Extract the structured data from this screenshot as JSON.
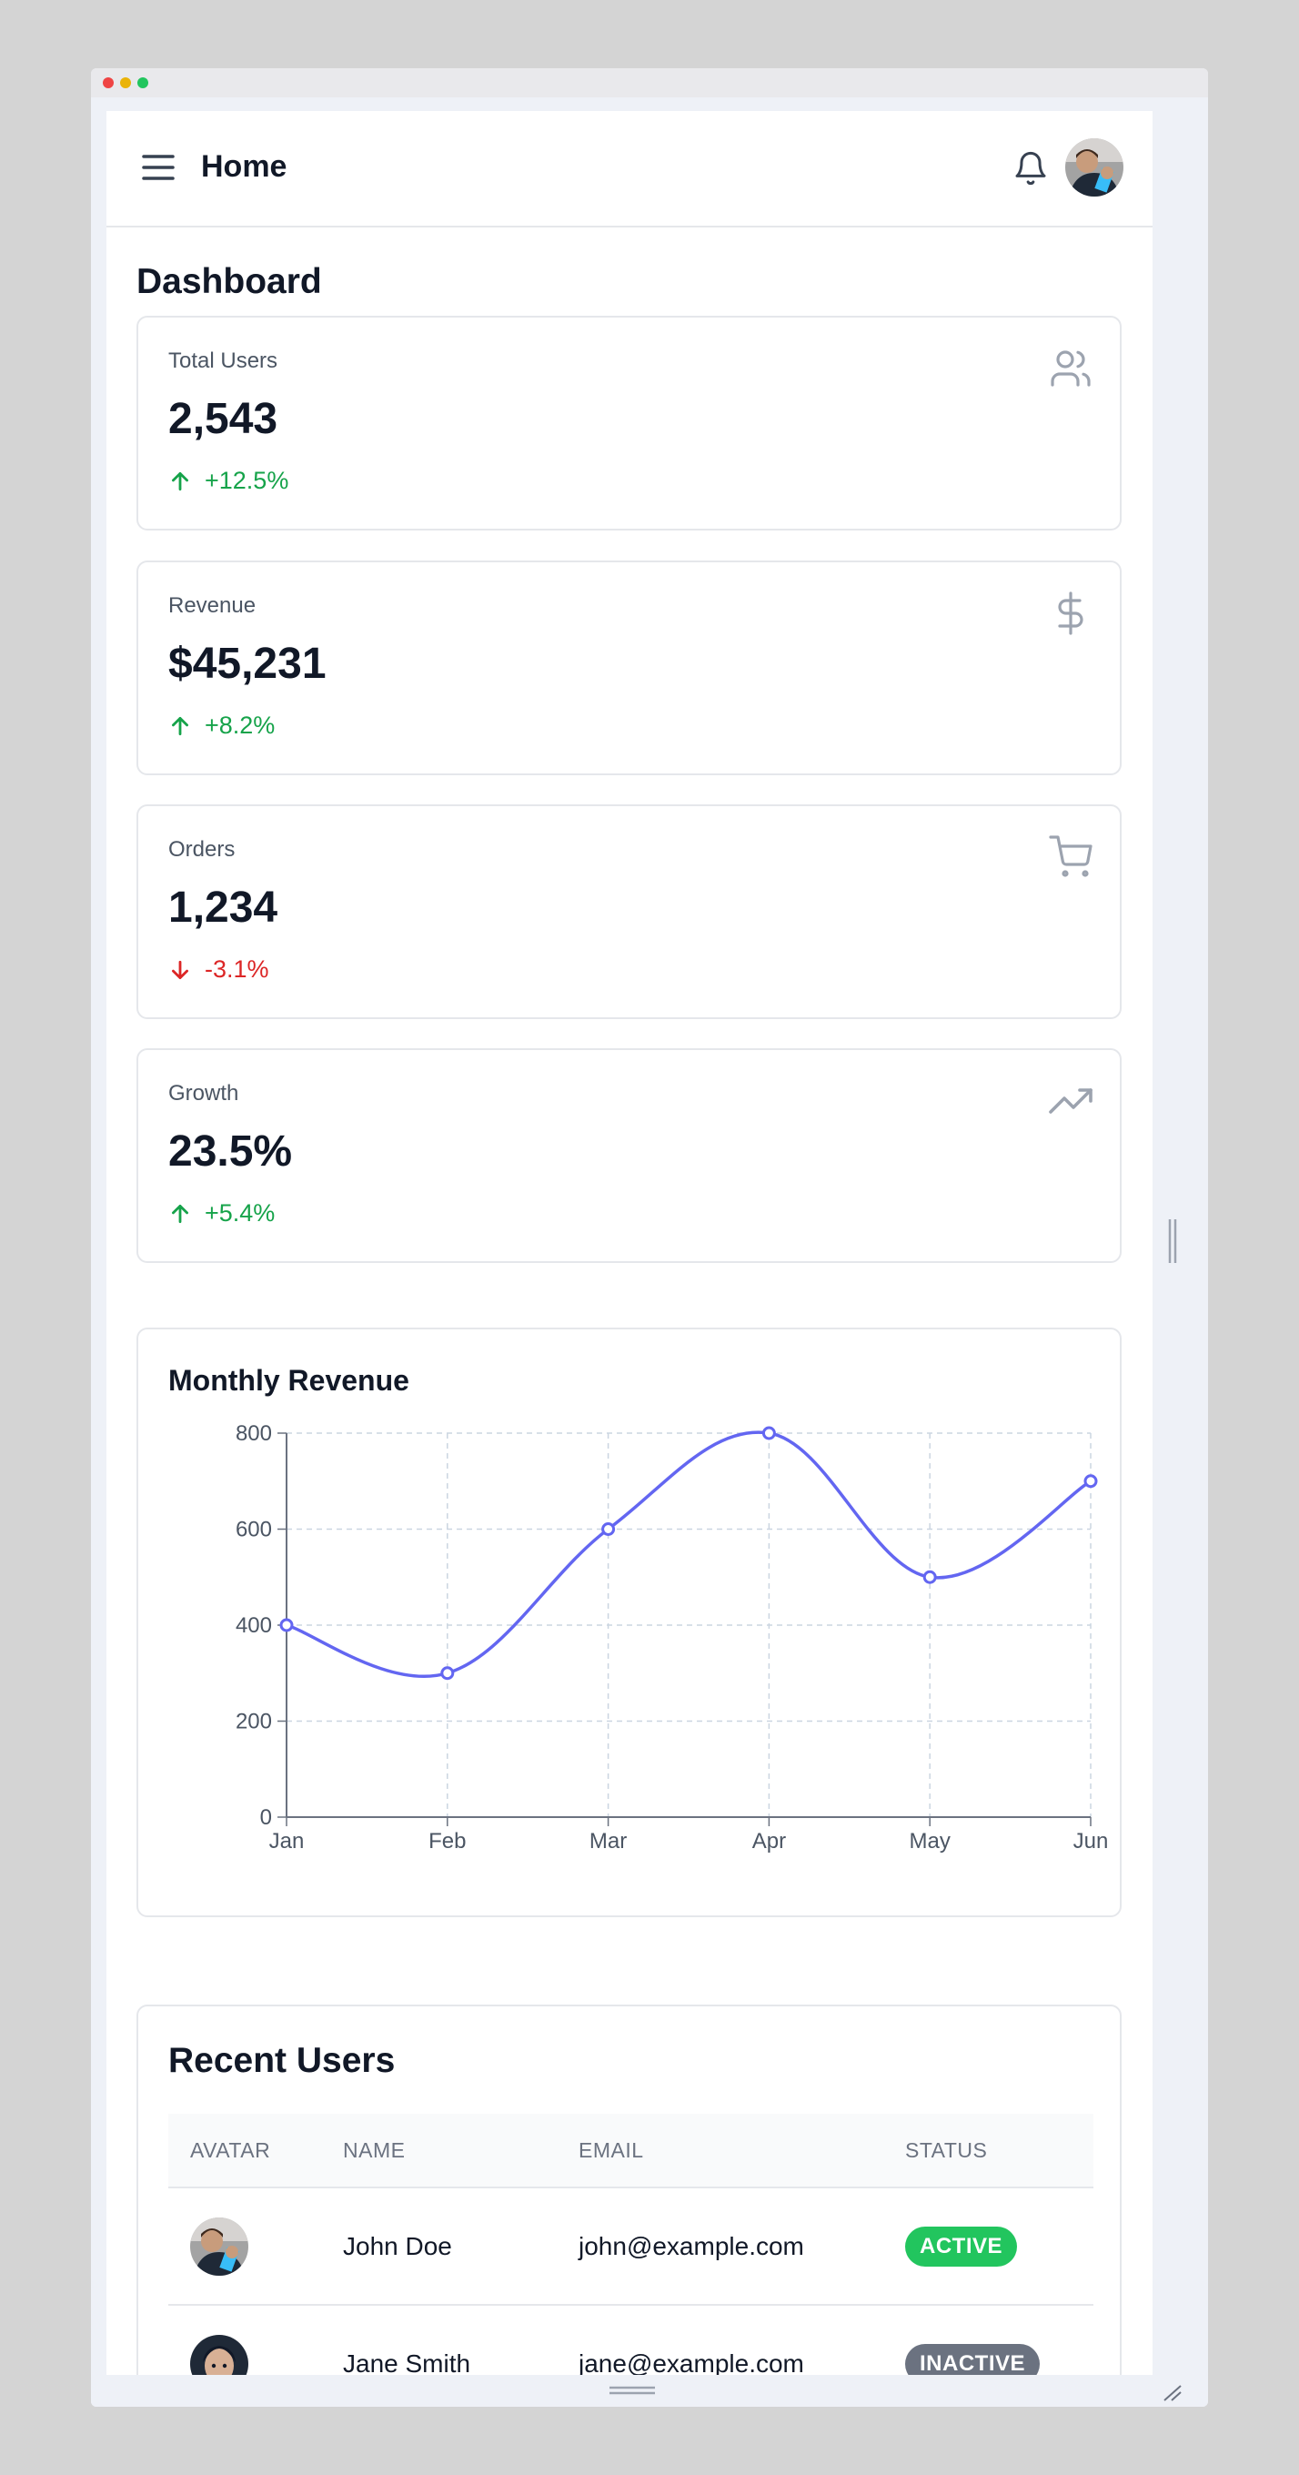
{
  "header": {
    "title": "Home"
  },
  "page": {
    "title": "Dashboard"
  },
  "stats": [
    {
      "label": "Total Users",
      "value": "2,543",
      "change": "+12.5%",
      "direction": "up",
      "icon": "users-icon"
    },
    {
      "label": "Revenue",
      "value": "$45,231",
      "change": "+8.2%",
      "direction": "up",
      "icon": "dollar-icon"
    },
    {
      "label": "Orders",
      "value": "1,234",
      "change": "-3.1%",
      "direction": "down",
      "icon": "cart-icon"
    },
    {
      "label": "Growth",
      "value": "23.5%",
      "change": "+5.4%",
      "direction": "up",
      "icon": "trending-up-icon"
    }
  ],
  "chart": {
    "title": "Monthly Revenue"
  },
  "chart_data": {
    "type": "line",
    "title": "Monthly Revenue",
    "categories": [
      "Jan",
      "Feb",
      "Mar",
      "Apr",
      "May",
      "Jun"
    ],
    "values": [
      400,
      300,
      600,
      800,
      500,
      700
    ],
    "yticks": [
      0,
      200,
      400,
      600,
      800
    ],
    "ylim": [
      0,
      800
    ],
    "grid": true,
    "line_color": "#6366f1"
  },
  "users": {
    "title": "Recent Users",
    "columns": [
      "AVATAR",
      "NAME",
      "EMAIL",
      "STATUS"
    ],
    "rows": [
      {
        "name": "John Doe",
        "email": "john@example.com",
        "status": "ACTIVE"
      },
      {
        "name": "Jane Smith",
        "email": "jane@example.com",
        "status": "INACTIVE"
      }
    ]
  },
  "colors": {
    "accent": "#6366f1",
    "positive": "#16a34a",
    "negative": "#dc2626",
    "active_badge": "#22c55e",
    "inactive_badge": "#6b7280"
  }
}
